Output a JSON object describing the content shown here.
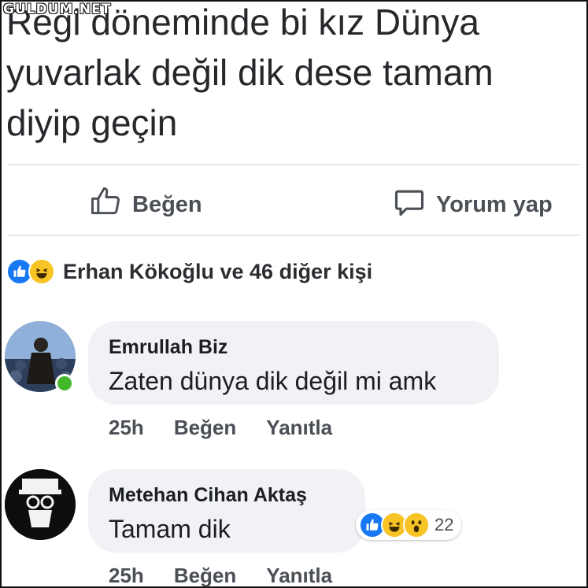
{
  "watermark": "GULDUM.NET",
  "post": {
    "text_lines": [
      "Regl döneminde bi kız Dünya",
      "yuvarlak değil dik dese tamam",
      "diyip geçin"
    ]
  },
  "actions": {
    "like_label": "Beğen",
    "comment_label": "Yorum yap"
  },
  "reactions": {
    "summary": "Erhan Kökoğlu ve 46 diğer kişi"
  },
  "comments": [
    {
      "author": "Emrullah Biz",
      "text": "Zaten dünya dik değil mi amk",
      "time": "25h",
      "like_label": "Beğen",
      "reply_label": "Yanıtla",
      "online": true
    },
    {
      "author": "Metehan Cihan Aktaş",
      "text": "Tamam dik",
      "time": "25h",
      "like_label": "Beğen",
      "reply_label": "Yanıtla",
      "reaction_count": "22"
    }
  ],
  "colors": {
    "like_blue": "#1877f2",
    "haha_yellow": "#f7c325",
    "bubble_gray": "#f0f2f5",
    "online_green": "#42b72a"
  }
}
